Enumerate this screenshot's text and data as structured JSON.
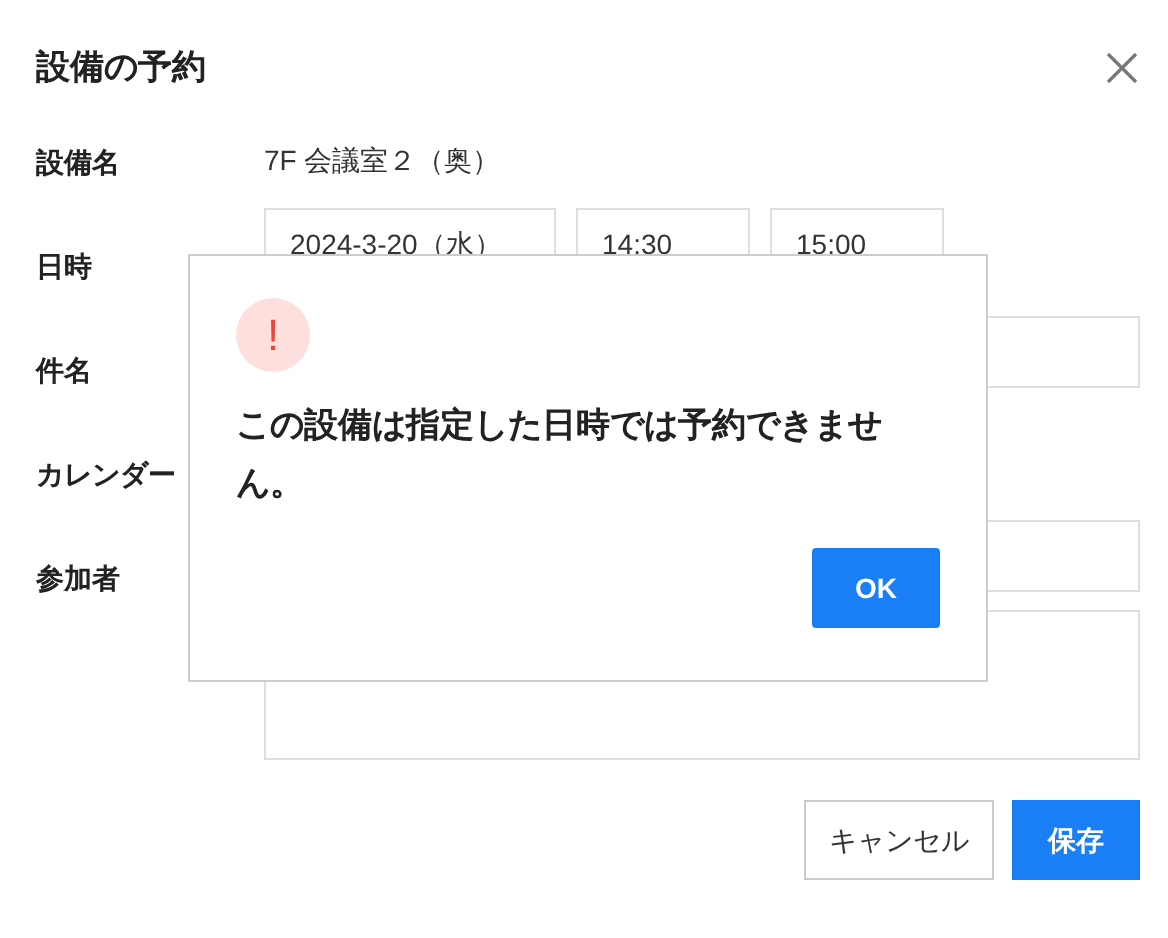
{
  "dialog": {
    "title": "設備の予約",
    "fields": [
      {
        "label": "設備名",
        "kind": "text",
        "value": "7F 会議室２（奥）"
      },
      {
        "label": "日時",
        "kind": "datetime",
        "values": [
          "2024-3-20（水）",
          "14:30",
          "15:00"
        ]
      },
      {
        "label": "件名",
        "kind": "input"
      },
      {
        "label": "カレンダー",
        "kind": "none"
      },
      {
        "label": "参加者",
        "kind": "participants"
      }
    ],
    "buttons": [
      {
        "label": "キャンセル",
        "kind": "secondary"
      },
      {
        "label": "保存",
        "kind": "primary"
      }
    ]
  },
  "alert": {
    "icon": "!",
    "message": "この設備は指定した日時では予約できません。",
    "button": "OK"
  }
}
